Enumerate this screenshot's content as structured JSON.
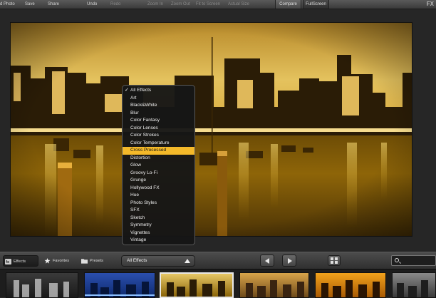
{
  "toolbar": {
    "items": [
      {
        "label": "d Photo",
        "enabled": true
      },
      {
        "label": "Save",
        "enabled": true
      },
      {
        "label": "Share",
        "enabled": true
      },
      {
        "label": "Undo",
        "enabled": true
      },
      {
        "label": "Redo",
        "enabled": false
      },
      {
        "label": "Zoom In",
        "enabled": false
      },
      {
        "label": "Zoom Out",
        "enabled": false
      },
      {
        "label": "Fit to Screen",
        "enabled": false
      },
      {
        "label": "Actual Size",
        "enabled": false
      }
    ],
    "compare_label": "Compare",
    "fullscreen_label": "FullScreen",
    "app_mark": "FX"
  },
  "effects_menu": {
    "checked_item": "All Effects",
    "selected_item": "Cross Processed",
    "items": [
      "All Effects",
      "Art",
      "Black&White",
      "Blur",
      "Color Fantasy",
      "Color Lenses",
      "Color Strokes",
      "Color Temperature",
      "Cross Processed",
      "Distortion",
      "Glow",
      "Groovy Lo-Fi",
      "Grunge",
      "Hollywood FX",
      "Hue",
      "Photo Styles",
      "SFX",
      "Sketch",
      "Symmetry",
      "Vignettes",
      "Vintage"
    ]
  },
  "bottom_bar": {
    "tabs": [
      {
        "label": "Effects",
        "icon": "fx-icon",
        "active": true
      },
      {
        "label": "Favorites",
        "icon": "star-icon",
        "active": false
      },
      {
        "label": "Presets",
        "icon": "presets-icon",
        "active": false
      }
    ],
    "category_select": "All Effects",
    "search_placeholder": ""
  },
  "filmstrip": {
    "thumbnails": [
      {
        "style": "black-white",
        "selected": false
      },
      {
        "style": "blue",
        "selected": false
      },
      {
        "style": "gold",
        "selected": true
      },
      {
        "style": "warm",
        "selected": false
      },
      {
        "style": "orange",
        "selected": false
      },
      {
        "style": "grayscale",
        "selected": false
      }
    ]
  },
  "colors": {
    "accent": "#f4b92a",
    "sky": "#e9c866",
    "water": "#8a6208",
    "background": "#262626"
  }
}
